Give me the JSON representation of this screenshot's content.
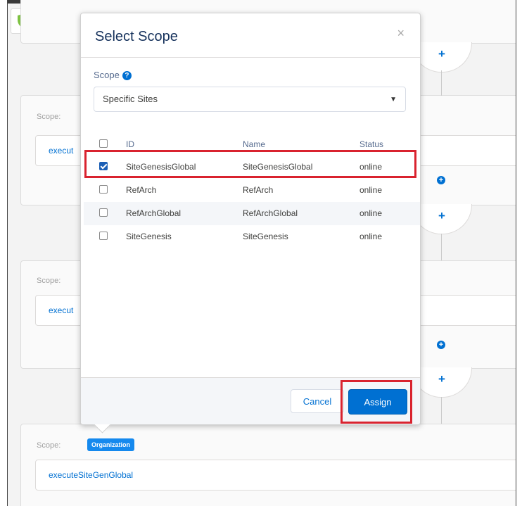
{
  "modal": {
    "title": "Select Scope",
    "close_symbol": "×",
    "scope_label": "Scope",
    "scope_info_icon": "info-icon",
    "scope_value": "Specific Sites",
    "columns": {
      "id": "ID",
      "name": "Name",
      "status": "Status"
    },
    "rows": [
      {
        "id": "SiteGenesisGlobal",
        "name": "SiteGenesisGlobal",
        "status": "online",
        "checked": true
      },
      {
        "id": "RefArch",
        "name": "RefArch",
        "status": "online",
        "checked": false
      },
      {
        "id": "RefArchGlobal",
        "name": "RefArchGlobal",
        "status": "online",
        "checked": false
      },
      {
        "id": "SiteGenesis",
        "name": "SiteGenesis",
        "status": "online",
        "checked": false
      }
    ],
    "cancel_label": "Cancel",
    "assign_label": "Assign"
  },
  "background": {
    "scope_label": "Scope:",
    "exec_partial": "execut",
    "org_badge": "Organization",
    "exec_full": "executeSiteGenGlobal",
    "plus_symbol": "+"
  },
  "colors": {
    "accent": "#0070d2",
    "highlight": "#d9232f",
    "badge": "#1589ee"
  }
}
